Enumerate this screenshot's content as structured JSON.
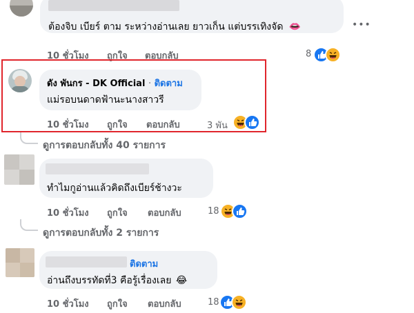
{
  "comments": [
    {
      "text": "ต้องจิบ เบียร์ ตาม ระหว่างอ่านเลย ยาวเก็น แต่บรรเทิงจัด",
      "text_emoji": "👄",
      "time": "10 ชั่วโมง",
      "like": "ถูกใจ",
      "reply": "ตอบกลับ",
      "reaction_count": "8",
      "menu": "•••"
    },
    {
      "author": "ดัง พันกร - DK Official",
      "separator": "·",
      "follow": "ติดตาม",
      "text": "แม่รอบนดาดฟ้านะนางสาวรี",
      "time": "10 ชั่วโมง",
      "like": "ถูกใจ",
      "reply": "ตอบกลับ",
      "reaction_count": "3 พัน"
    },
    {
      "replies_link": "ดูการตอบกลับทั้ง 40 รายการ"
    },
    {
      "text": "ทำไมกูอ่านแล้วคิดถึงเบียร์ช้างวะ",
      "time": "10 ชั่วโมง",
      "like": "ถูกใจ",
      "reply": "ตอบกลับ",
      "reaction_count": "18"
    },
    {
      "replies_link": "ดูการตอบกลับทั้ง 2 รายการ"
    },
    {
      "follow": "ติดตาม",
      "text": "อ่านถึงบรรทัดที่3 คือรู้เรื่องเลย",
      "text_emoji": "😂",
      "time": "10 ชั่วโมง",
      "like": "ถูกใจ",
      "reply": "ตอบกลับ",
      "reaction_count": "18"
    }
  ],
  "colors": {
    "highlight_border": "#e0242b",
    "link_blue": "#1b74e4",
    "like_blue": "#1877f2",
    "haha_yellow": "#f7b125",
    "meta_gray": "#65676b",
    "bubble_bg": "#f0f2f5"
  },
  "icons": [
    "like-reaction-icon",
    "haha-reaction-icon",
    "lips-emoji-icon",
    "laughing-tears-emoji-icon",
    "more-options-icon"
  ]
}
